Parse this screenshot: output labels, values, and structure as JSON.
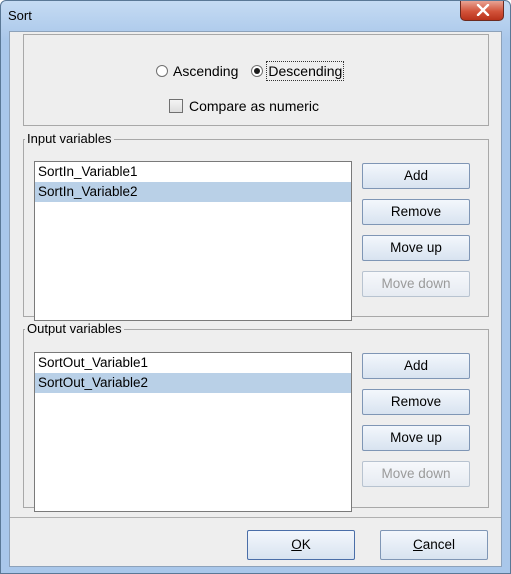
{
  "window": {
    "title": "Sort"
  },
  "sort_order": {
    "ascending_label": "Ascending",
    "descending_label": "Descending",
    "selected": "Descending"
  },
  "compare_numeric": {
    "label": "Compare as numeric",
    "checked": false
  },
  "input_variables": {
    "legend": "Input variables",
    "items": [
      "SortIn_Variable1",
      "SortIn_Variable2"
    ],
    "selected_index": 1,
    "buttons": {
      "add": "Add",
      "remove": "Remove",
      "move_up": "Move up",
      "move_down": "Move down"
    }
  },
  "output_variables": {
    "legend": "Output variables",
    "items": [
      "SortOut_Variable1",
      "SortOut_Variable2"
    ],
    "selected_index": 1,
    "buttons": {
      "add": "Add",
      "remove": "Remove",
      "move_up": "Move up",
      "move_down": "Move down"
    }
  },
  "footer": {
    "ok_mnemonic": "O",
    "ok_rest": "K",
    "cancel_mnemonic": "C",
    "cancel_rest": "ancel"
  },
  "colors": {
    "selection": "#b9d0e7",
    "close_button": "#c8452c"
  },
  "icons": {
    "close": "close-x-icon"
  }
}
